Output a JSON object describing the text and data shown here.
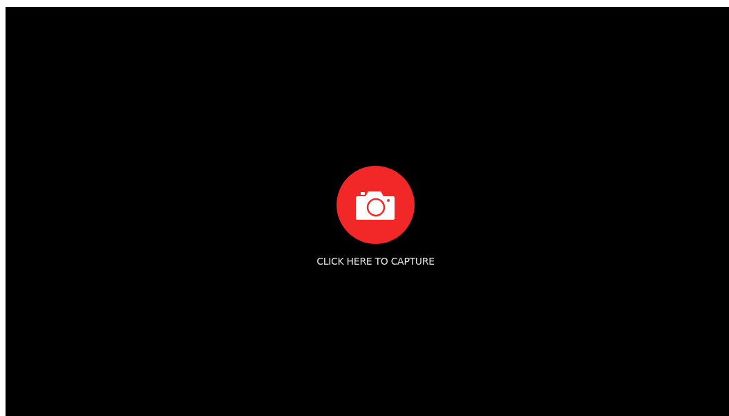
{
  "capture": {
    "label": "CLICK HERE TO CAPTURE"
  }
}
